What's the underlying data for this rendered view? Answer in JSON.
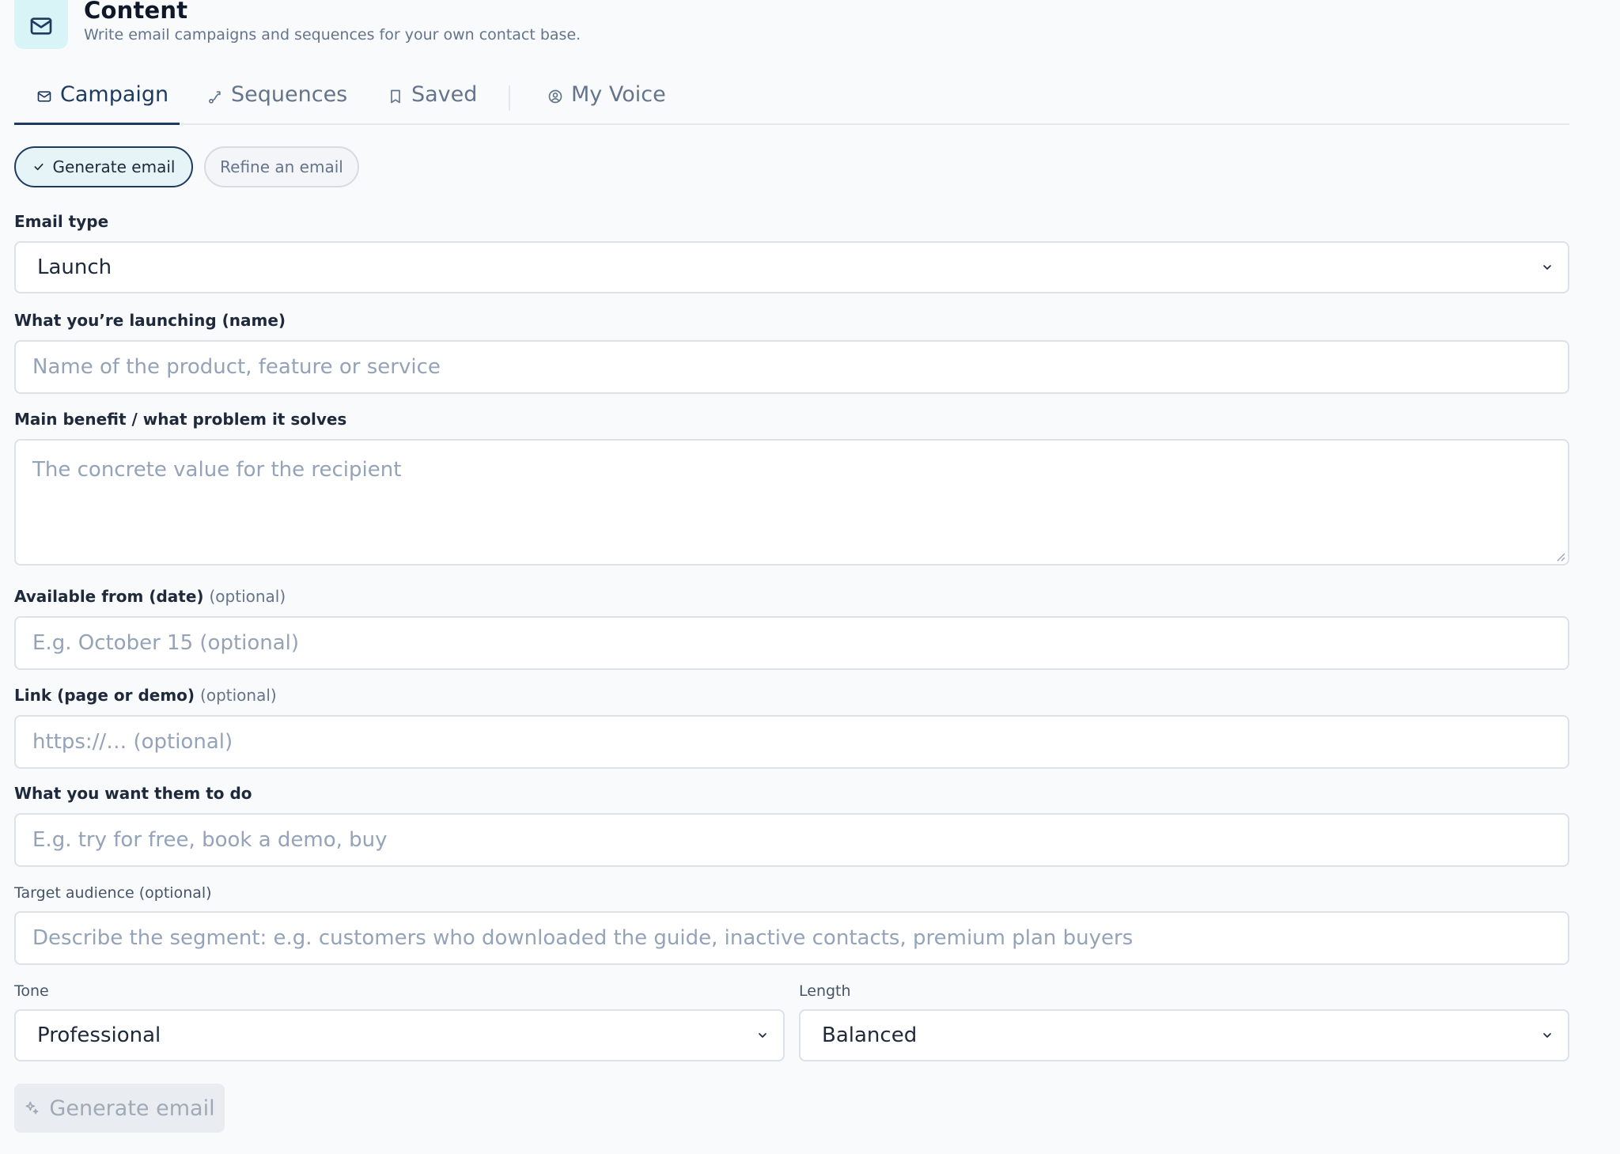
{
  "header": {
    "icon": "mail-icon",
    "title": "Content",
    "subtitle": "Write email campaigns and sequences for your own contact base."
  },
  "tabs": [
    {
      "label": "Campaign",
      "icon": "mail-icon",
      "active": true
    },
    {
      "label": "Sequences",
      "icon": "route-icon",
      "active": false
    },
    {
      "label": "Saved",
      "icon": "bookmark-icon",
      "active": false
    },
    {
      "label": "My Voice",
      "icon": "user-circle-icon",
      "active": false
    }
  ],
  "modes": {
    "generate": "Generate email",
    "refine": "Refine an email",
    "selected": "generate"
  },
  "form": {
    "email_type": {
      "label": "Email type",
      "value": "Launch"
    },
    "launch_name": {
      "label": "What you’re launching (name)",
      "placeholder": "Name of the product, feature or service"
    },
    "main_benefit": {
      "label": "Main benefit / what problem it solves",
      "placeholder": "The concrete value for the recipient"
    },
    "available_from": {
      "label": "Available from (date)",
      "optional": "(optional)",
      "placeholder": "E.g. October 15 (optional)"
    },
    "link": {
      "label": "Link (page or demo)",
      "optional": "(optional)",
      "placeholder": "https://… (optional)"
    },
    "cta": {
      "label": "What you want them to do",
      "placeholder": "E.g. try for free, book a demo, buy"
    },
    "audience": {
      "label": "Target audience (optional)",
      "placeholder": "Describe the segment: e.g. customers who downloaded the guide, inactive contacts, premium plan buyers"
    },
    "tone": {
      "label": "Tone",
      "value": "Professional"
    },
    "length": {
      "label": "Length",
      "value": "Balanced"
    }
  },
  "submit": {
    "label": "Generate email",
    "icon": "sparkles-icon",
    "disabled": true
  },
  "colors": {
    "accent": "#1e3a5f",
    "icon_bg": "#d9f4f7",
    "page_bg": "#f8fafc",
    "border": "#dde2e8"
  }
}
